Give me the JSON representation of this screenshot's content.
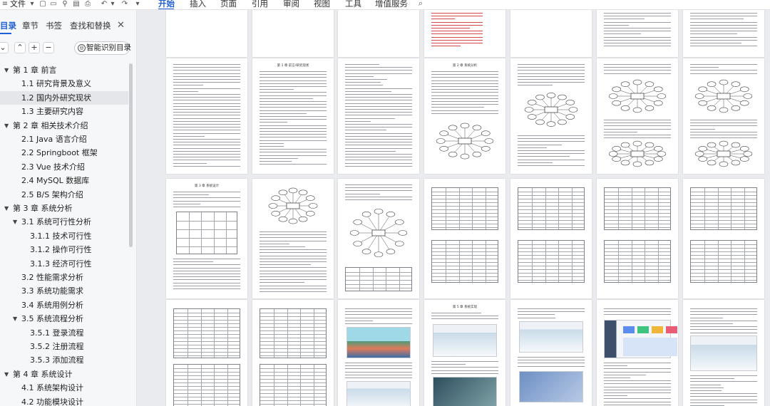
{
  "toolbar": {
    "file_label": "文件",
    "tabs": [
      "开始",
      "插入",
      "页面",
      "引用",
      "审阅",
      "视图",
      "工具",
      "增值服务"
    ],
    "active_tab": "开始"
  },
  "nav": {
    "tabs": [
      "目录",
      "章节",
      "书签",
      "查找和替换"
    ],
    "active_tab": "目录",
    "smart_button_label": "智能识别目录",
    "items": [
      {
        "label": "第 1 章  前言",
        "level": 0,
        "caret": "▼"
      },
      {
        "label": "1.1 研究背景及意义",
        "level": 1
      },
      {
        "label": "1.2 国内外研究现状",
        "level": 1,
        "selected": true
      },
      {
        "label": "1.3 主要研究内容",
        "level": 1
      },
      {
        "label": "第 2 章  相关技术介绍",
        "level": 0,
        "caret": "▼"
      },
      {
        "label": "2.1 Java 语言介绍",
        "level": 1
      },
      {
        "label": "2.2 Springboot 框架",
        "level": 1
      },
      {
        "label": "2.3 Vue 技术介绍",
        "level": 1
      },
      {
        "label": "2.4 MySQL 数据库",
        "level": 1
      },
      {
        "label": "2.5 B/S 架构介绍",
        "level": 1
      },
      {
        "label": "第 3 章  系统分析",
        "level": 0,
        "caret": "▼"
      },
      {
        "label": "3.1  系统可行性分析",
        "level": 1,
        "caret": "▼"
      },
      {
        "label": "3.1.1  技术可行性",
        "level": 2
      },
      {
        "label": "3.1.2  操作可行性",
        "level": 2
      },
      {
        "label": "3.1.3  经济可行性",
        "level": 2
      },
      {
        "label": "3.2 性能需求分析",
        "level": 1
      },
      {
        "label": "3.3 系统功能需求",
        "level": 1
      },
      {
        "label": "3.4  系统用例分析",
        "level": 1
      },
      {
        "label": "3.5  系统流程分析",
        "level": 1,
        "caret": "▼"
      },
      {
        "label": "3.5.1  登录流程",
        "level": 2
      },
      {
        "label": "3.5.2  注册流程",
        "level": 2
      },
      {
        "label": "3.5.3  添加流程",
        "level": 2
      },
      {
        "label": "第 4 章  系统设计",
        "level": 0,
        "caret": "▼"
      },
      {
        "label": "4.1  系统架构设计",
        "level": 1
      },
      {
        "label": "4.2 功能模块设计",
        "level": 1
      }
    ]
  },
  "page_titles": {
    "r1c1": "第 1 章  前言/研究现状",
    "r1c3": "第 2 章  系统分析",
    "r2c0": "第 3 章  系统设计",
    "r3c3": "第 5 章  系统实现"
  },
  "colors": {
    "accent": "#1f5fd6",
    "canvas": "#e9ebee",
    "nav_bg": "#f6f7f9",
    "selected_row": "#e4e6ea"
  }
}
